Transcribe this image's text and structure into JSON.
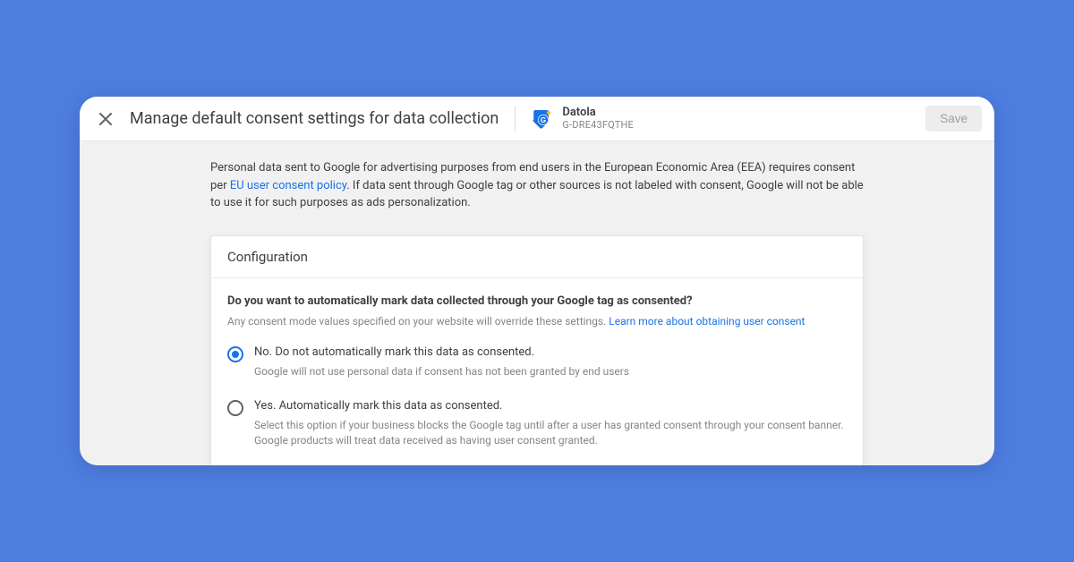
{
  "header": {
    "title": "Manage default consent settings for data collection",
    "property_name": "Datola",
    "property_id": "G-DRE43FQTHE",
    "save_label": "Save"
  },
  "intro": {
    "text_before": "Personal data sent to Google for advertising purposes from end users in the European Economic Area (EEA) requires consent per ",
    "link": "EU user consent policy",
    "text_after": ". If data sent through Google tag or other sources is not labeled with consent, Google will not be able to use it for such purposes as ads personalization."
  },
  "card": {
    "title": "Configuration",
    "question": "Do you want to automatically mark data collected through your Google tag as consented?",
    "help_before": "Any consent mode values specified on your website will override these settings. ",
    "help_link": "Learn more about obtaining user consent",
    "options": [
      {
        "label": "No. Do not automatically mark this data as consented.",
        "desc": "Google will not use personal data if consent has not been granted by end users",
        "selected": true
      },
      {
        "label": "Yes. Automatically mark this data as consented.",
        "desc": "Select this option if your business blocks the Google tag until after a user has granted consent through your consent banner. Google products will treat data received as having user consent granted.",
        "selected": false
      }
    ]
  }
}
